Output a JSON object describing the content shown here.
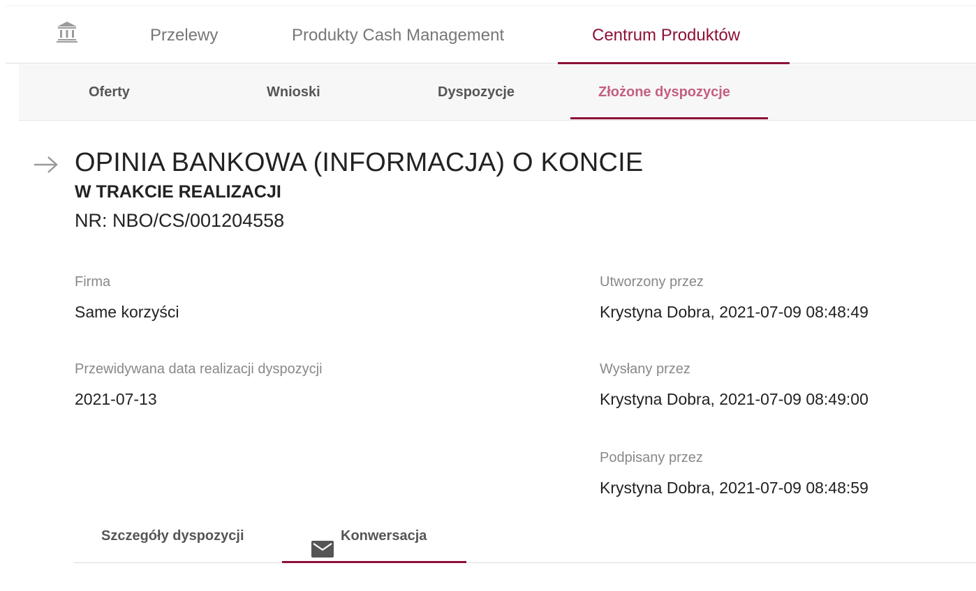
{
  "topnav": {
    "icon": "bank-icon",
    "items": [
      {
        "label": "Przelewy",
        "active": false
      },
      {
        "label": "Produkty Cash Management",
        "active": false
      },
      {
        "label": "Centrum Produktów",
        "active": true
      }
    ]
  },
  "subnav": {
    "items": [
      {
        "label": "Oferty",
        "active": false
      },
      {
        "label": "Wnioski",
        "active": false
      },
      {
        "label": "Dyspozycje",
        "active": false
      },
      {
        "label": "Złożone dyspozycje",
        "active": true
      }
    ]
  },
  "header": {
    "back_icon": "arrow-right-icon",
    "title": "OPINIA BANKOWA (INFORMACJA) O KONCIE",
    "status": "W TRAKCIE REALIZACJI",
    "number": "NR: NBO/CS/001204558"
  },
  "details": {
    "company": {
      "label": "Firma",
      "value": "Same korzyści"
    },
    "expected_date": {
      "label": "Przewidywana data realizacji dyspozycji",
      "value": "2021-07-13"
    },
    "created_by": {
      "label": "Utworzony przez",
      "value": "Krystyna Dobra, 2021-07-09 08:48:49"
    },
    "sent_by": {
      "label": "Wysłany przez",
      "value": "Krystyna Dobra, 2021-07-09 08:49:00"
    },
    "signed_by": {
      "label": "Podpisany przez",
      "value": "Krystyna Dobra, 2021-07-09 08:48:59"
    }
  },
  "tabs": {
    "items": [
      {
        "label": "Szczegóły dyspozycji",
        "active": false
      },
      {
        "label": "Konwersacja",
        "active": true,
        "icon": "mail-icon"
      }
    ]
  },
  "colors": {
    "accent": "#8c1137",
    "accent_light": "#c45f80",
    "subnav_bg": "#f7f7f7",
    "muted_text": "#888888"
  }
}
